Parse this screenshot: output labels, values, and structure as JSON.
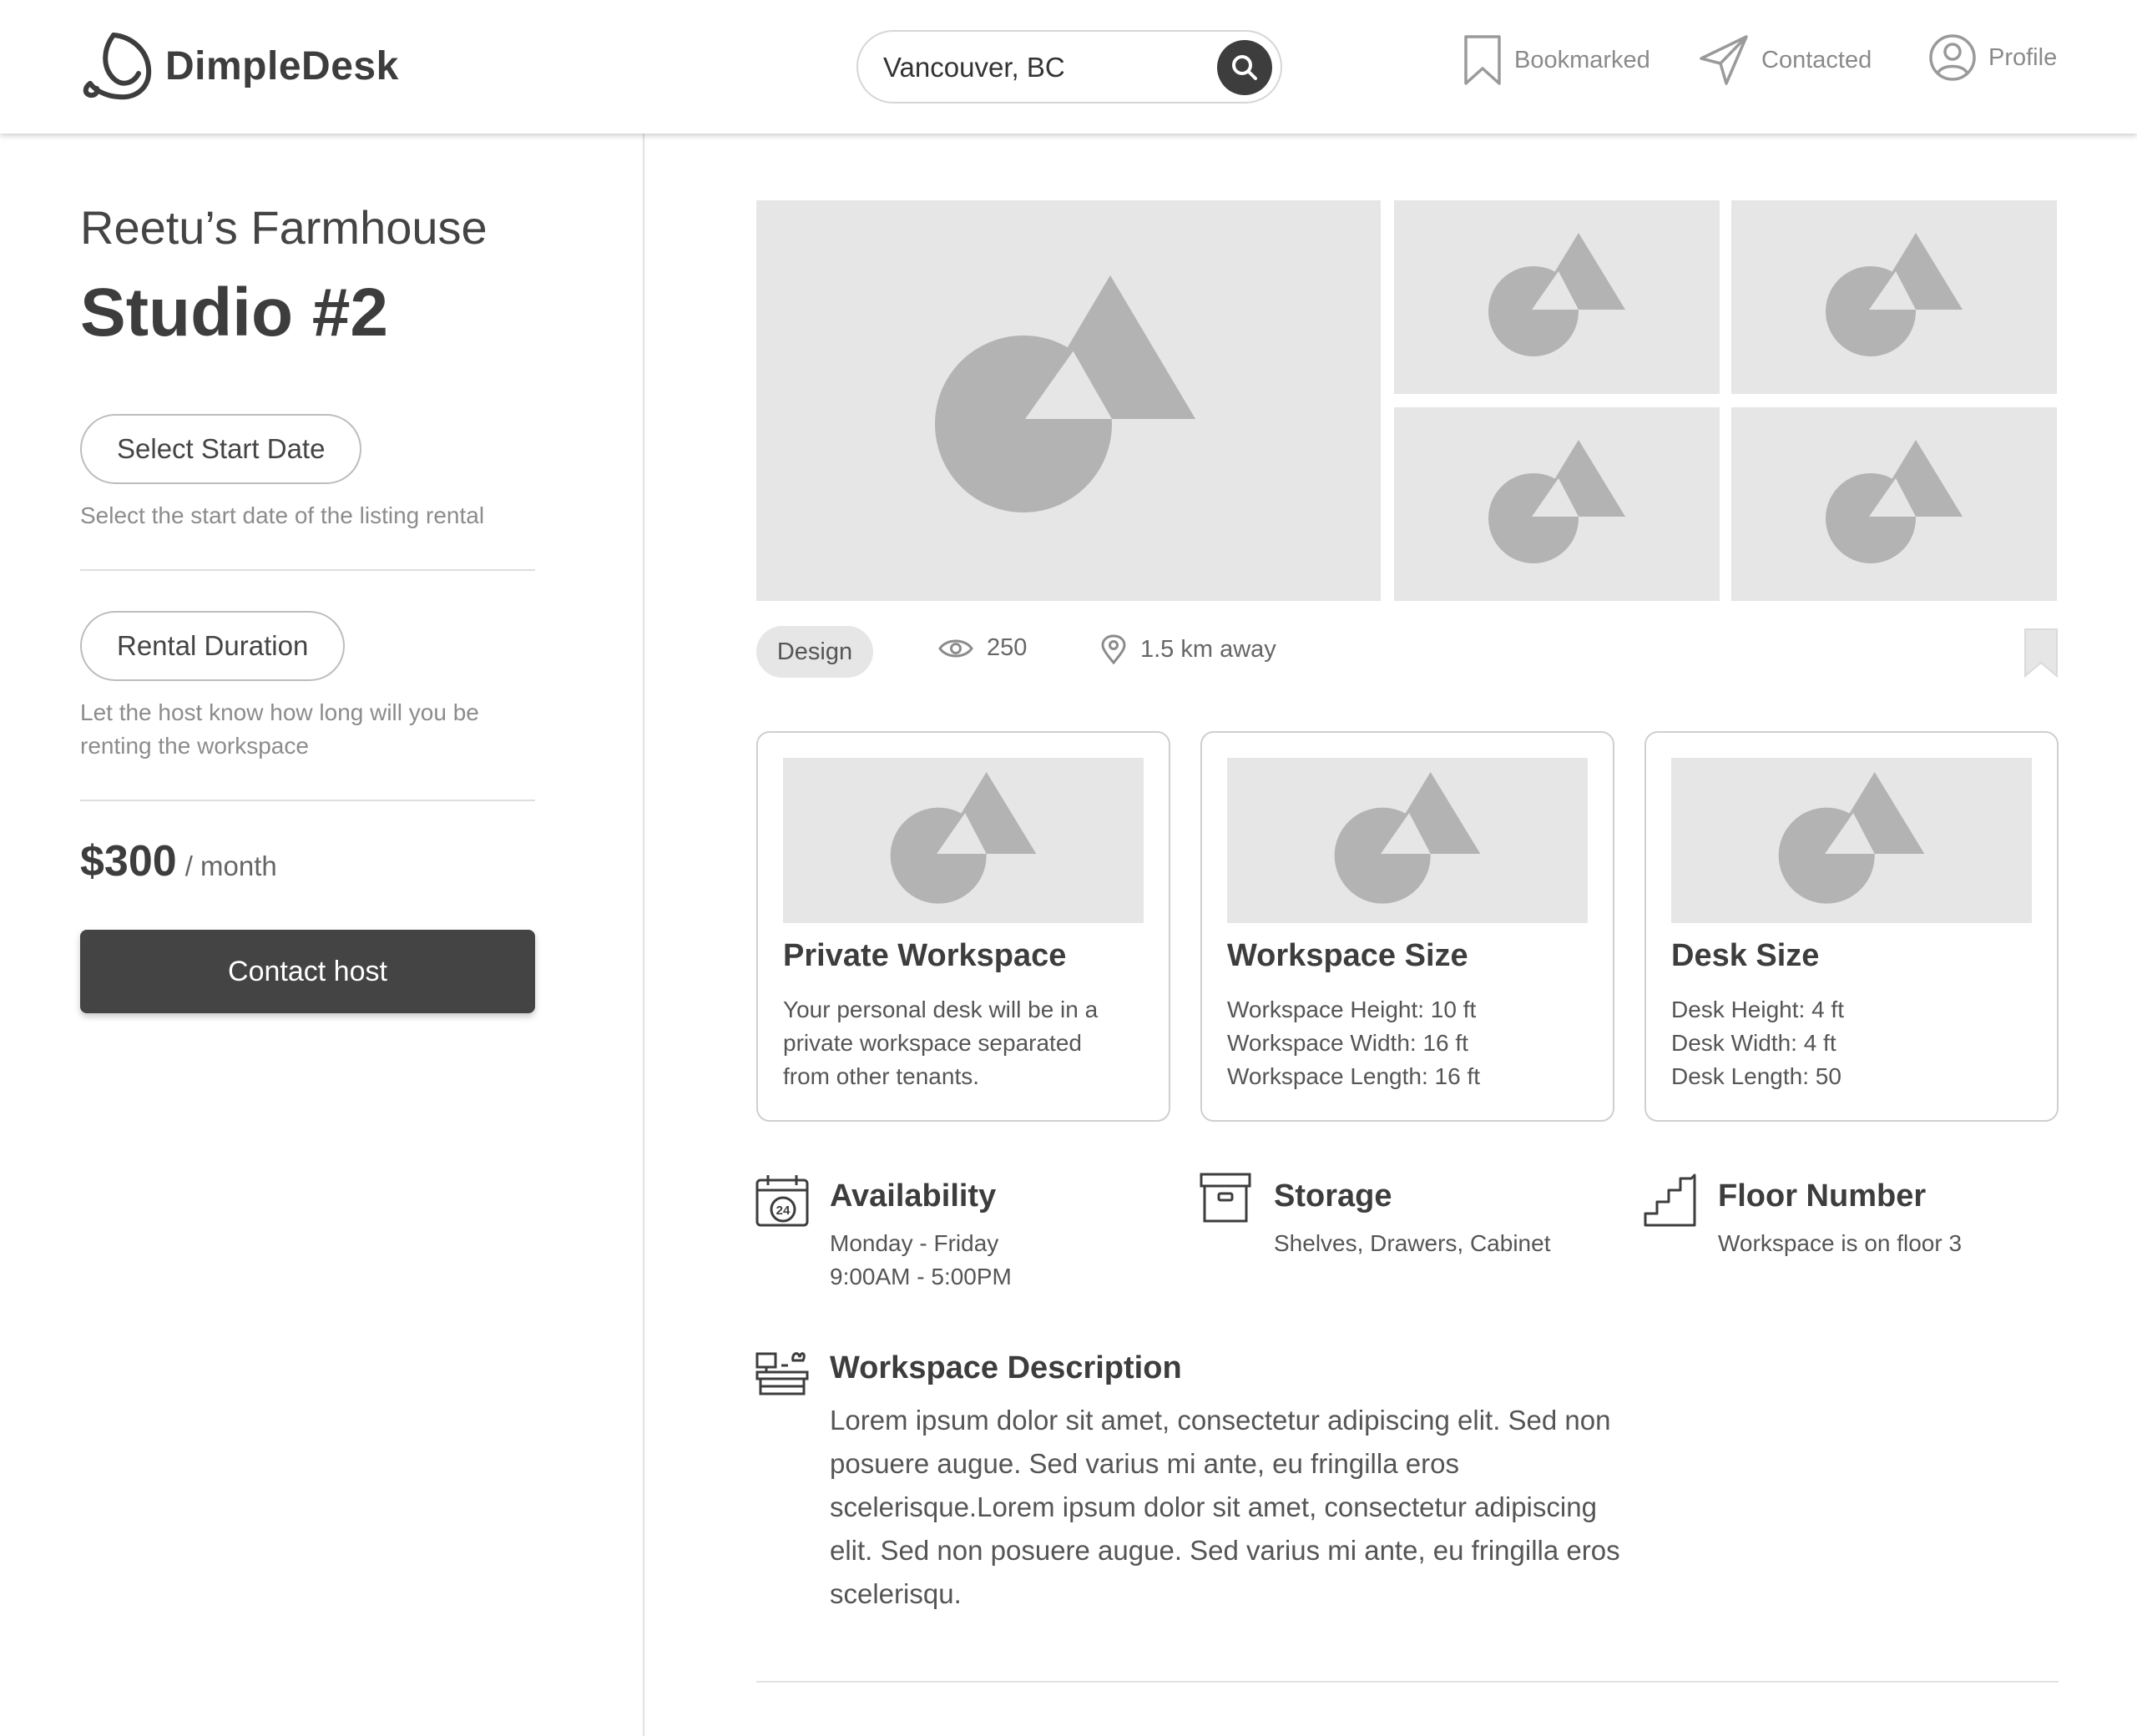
{
  "app": {
    "name": "DimpleDesk"
  },
  "search": {
    "value": "Vancouver, BC"
  },
  "nav": {
    "bookmarked": "Bookmarked",
    "contacted": "Contacted",
    "profile": "Profile"
  },
  "listing": {
    "subtitle": "Reetu’s Farmhouse",
    "title": "Studio #2"
  },
  "booking": {
    "start_date_label": "Select Start Date",
    "start_date_help": "Select the start date of the listing rental",
    "duration_label": "Rental Duration",
    "duration_help": "Let the host know how long will you be renting the workspace",
    "price": "$300",
    "price_unit": "/ month",
    "contact_label": "Contact host"
  },
  "meta": {
    "tag": "Design",
    "views": "250",
    "distance": "1.5 km away"
  },
  "features": [
    {
      "title": "Private Workspace",
      "lines": [
        "Your personal desk will be in a",
        "private workspace separated",
        "from other tenants."
      ]
    },
    {
      "title": "Workspace Size",
      "lines": [
        "Workspace Height: 10 ft",
        "Workspace Width: 16 ft",
        "Workspace Length: 16 ft"
      ]
    },
    {
      "title": "Desk Size",
      "lines": [
        "Desk Height: 4 ft",
        "Desk Width: 4 ft",
        "Desk Length: 50"
      ]
    }
  ],
  "info": {
    "availability": {
      "title": "Availability",
      "lines": [
        "Monday - Friday",
        "9:00AM - 5:00PM"
      ],
      "icon": "calendar-24-icon"
    },
    "storage": {
      "title": "Storage",
      "lines": [
        "Shelves, Drawers, Cabinet"
      ],
      "icon": "archive-box-icon"
    },
    "floor": {
      "title": "Floor Number",
      "lines": [
        "Workspace is on floor 3"
      ],
      "icon": "stairs-icon"
    }
  },
  "description": {
    "title": "Workspace Description",
    "text": "Lorem ipsum dolor sit amet, consectetur adipiscing elit. Sed non posuere augue. Sed varius mi ante, eu fringilla eros scelerisque.Lorem ipsum dolor sit amet, consectetur adipiscing elit. Sed non posuere augue. Sed varius mi ante, eu fringilla eros scelerisqu.",
    "icon": "desk-icon"
  },
  "colors": {
    "text": "#3d3d3d",
    "muted": "#8a8a8a",
    "placeholder_bg": "#e6e6e6",
    "placeholder_shape": "#b3b3b3",
    "button_dark": "#444444"
  }
}
